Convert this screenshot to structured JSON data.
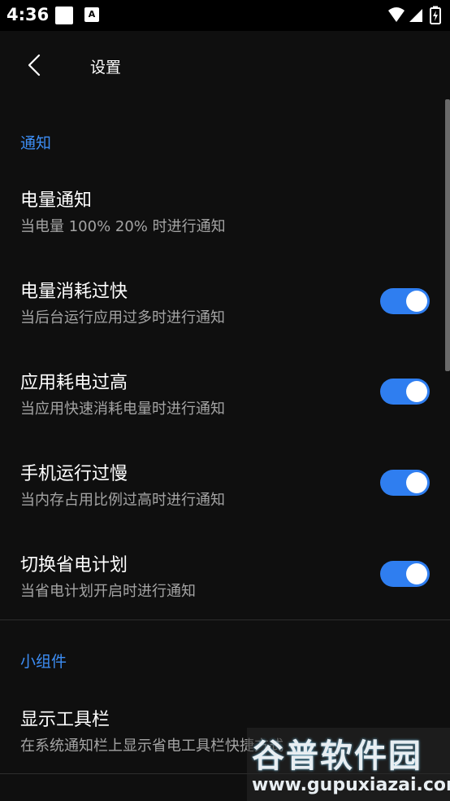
{
  "status_bar": {
    "time": "4:36",
    "notif_icon_1": "square-notification-icon",
    "notif_icon_2_label": "A",
    "icons": [
      "wifi-icon",
      "signal-icon",
      "battery-charging-icon"
    ]
  },
  "app_bar": {
    "title": "设置",
    "back_icon": "chevron-left-icon"
  },
  "sections": {
    "notify": {
      "header": "通知",
      "items": [
        {
          "title": "电量通知",
          "subtitle": "当电量 100% 20% 时进行通知",
          "has_toggle": false
        },
        {
          "title": "电量消耗过快",
          "subtitle": "当后台运行应用过多时进行通知",
          "has_toggle": true,
          "on": true
        },
        {
          "title": "应用耗电过高",
          "subtitle": "当应用快速消耗电量时进行通知",
          "has_toggle": true,
          "on": true
        },
        {
          "title": "手机运行过慢",
          "subtitle": "当内存占用比例过高时进行通知",
          "has_toggle": true,
          "on": true
        },
        {
          "title": "切换省电计划",
          "subtitle": "当省电计划开启时进行通知",
          "has_toggle": true,
          "on": true
        }
      ]
    },
    "widgets": {
      "header": "小组件",
      "items": [
        {
          "title": "显示工具栏",
          "subtitle": "在系统通知栏上显示省电工具栏快捷方式",
          "has_toggle": false
        }
      ]
    }
  },
  "watermark": {
    "title": "谷普软件园",
    "url": "www.gupuxiazai.com"
  },
  "colors": {
    "accent": "#3d8ef5",
    "toggle_on": "#2f7ef0",
    "background": "#0f0f0f",
    "subtitle": "#a4a4a4"
  }
}
